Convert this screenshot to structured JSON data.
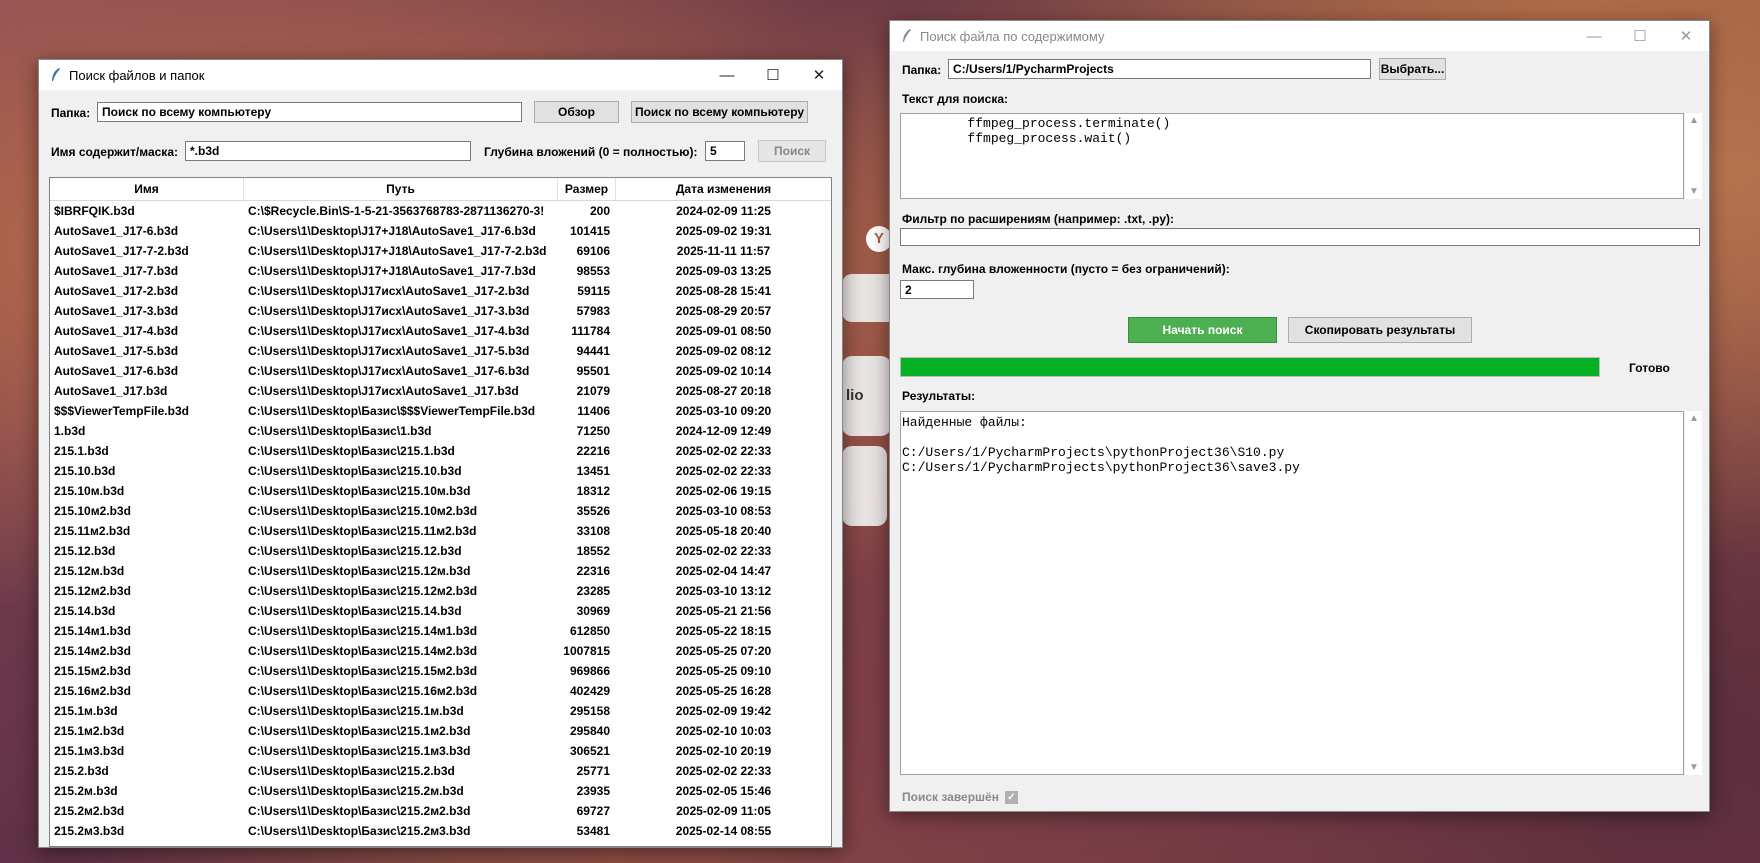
{
  "background": {
    "side_text": "lio"
  },
  "left_window": {
    "title": "Поиск файлов и папок",
    "folder_label": "Папка:",
    "folder_value": "Поиск по всему компьютеру",
    "browse_button": "Обзор",
    "search_all_button": "Поиск по всему компьютеру",
    "mask_label": "Имя содержит/маска:",
    "mask_value": "*.b3d",
    "depth_label": "Глубина вложений (0 = полностью):",
    "depth_value": "5",
    "search_button": "Поиск",
    "columns": [
      "Имя",
      "Путь",
      "Размер",
      "Дата изменения"
    ],
    "rows": [
      [
        "$IBRFQIK.b3d",
        "C:\\$Recycle.Bin\\S-1-5-21-3563768783-2871136270-3!",
        "200",
        "2024-02-09 11:25"
      ],
      [
        "AutoSave1_J17-6.b3d",
        "C:\\Users\\1\\Desktop\\J17+J18\\AutoSave1_J17-6.b3d",
        "101415",
        "2025-09-02 19:31"
      ],
      [
        "AutoSave1_J17-7-2.b3d",
        "C:\\Users\\1\\Desktop\\J17+J18\\AutoSave1_J17-7-2.b3d",
        "69106",
        "2025-11-11 11:57"
      ],
      [
        "AutoSave1_J17-7.b3d",
        "C:\\Users\\1\\Desktop\\J17+J18\\AutoSave1_J17-7.b3d",
        "98553",
        "2025-09-03 13:25"
      ],
      [
        "AutoSave1_J17-2.b3d",
        "C:\\Users\\1\\Desktop\\J17исх\\AutoSave1_J17-2.b3d",
        "59115",
        "2025-08-28 15:41"
      ],
      [
        "AutoSave1_J17-3.b3d",
        "C:\\Users\\1\\Desktop\\J17исх\\AutoSave1_J17-3.b3d",
        "57983",
        "2025-08-29 20:57"
      ],
      [
        "AutoSave1_J17-4.b3d",
        "C:\\Users\\1\\Desktop\\J17исх\\AutoSave1_J17-4.b3d",
        "111784",
        "2025-09-01 08:50"
      ],
      [
        "AutoSave1_J17-5.b3d",
        "C:\\Users\\1\\Desktop\\J17исх\\AutoSave1_J17-5.b3d",
        "94441",
        "2025-09-02 08:12"
      ],
      [
        "AutoSave1_J17-6.b3d",
        "C:\\Users\\1\\Desktop\\J17исх\\AutoSave1_J17-6.b3d",
        "95501",
        "2025-09-02 10:14"
      ],
      [
        "AutoSave1_J17.b3d",
        "C:\\Users\\1\\Desktop\\J17исх\\AutoSave1_J17.b3d",
        "21079",
        "2025-08-27 20:18"
      ],
      [
        "$$$ViewerTempFile.b3d",
        "C:\\Users\\1\\Desktop\\Базис\\$$$ViewerTempFile.b3d",
        "11406",
        "2025-03-10 09:20"
      ],
      [
        "1.b3d",
        "C:\\Users\\1\\Desktop\\Базис\\1.b3d",
        "71250",
        "2024-12-09 12:49"
      ],
      [
        "215.1.b3d",
        "C:\\Users\\1\\Desktop\\Базис\\215.1.b3d",
        "22216",
        "2025-02-02 22:33"
      ],
      [
        "215.10.b3d",
        "C:\\Users\\1\\Desktop\\Базис\\215.10.b3d",
        "13451",
        "2025-02-02 22:33"
      ],
      [
        "215.10м.b3d",
        "C:\\Users\\1\\Desktop\\Базис\\215.10м.b3d",
        "18312",
        "2025-02-06 19:15"
      ],
      [
        "215.10м2.b3d",
        "C:\\Users\\1\\Desktop\\Базис\\215.10м2.b3d",
        "35526",
        "2025-03-10 08:53"
      ],
      [
        "215.11м2.b3d",
        "C:\\Users\\1\\Desktop\\Базис\\215.11м2.b3d",
        "33108",
        "2025-05-18 20:40"
      ],
      [
        "215.12.b3d",
        "C:\\Users\\1\\Desktop\\Базис\\215.12.b3d",
        "18552",
        "2025-02-02 22:33"
      ],
      [
        "215.12м.b3d",
        "C:\\Users\\1\\Desktop\\Базис\\215.12м.b3d",
        "22316",
        "2025-02-04 14:47"
      ],
      [
        "215.12м2.b3d",
        "C:\\Users\\1\\Desktop\\Базис\\215.12м2.b3d",
        "23285",
        "2025-03-10 13:12"
      ],
      [
        "215.14.b3d",
        "C:\\Users\\1\\Desktop\\Базис\\215.14.b3d",
        "30969",
        "2025-05-21 21:56"
      ],
      [
        "215.14м1.b3d",
        "C:\\Users\\1\\Desktop\\Базис\\215.14м1.b3d",
        "612850",
        "2025-05-22 18:15"
      ],
      [
        "215.14м2.b3d",
        "C:\\Users\\1\\Desktop\\Базис\\215.14м2.b3d",
        "1007815",
        "2025-05-25 07:20"
      ],
      [
        "215.15м2.b3d",
        "C:\\Users\\1\\Desktop\\Базис\\215.15м2.b3d",
        "969866",
        "2025-05-25 09:10"
      ],
      [
        "215.16м2.b3d",
        "C:\\Users\\1\\Desktop\\Базис\\215.16м2.b3d",
        "402429",
        "2025-05-25 16:28"
      ],
      [
        "215.1м.b3d",
        "C:\\Users\\1\\Desktop\\Базис\\215.1м.b3d",
        "295158",
        "2025-02-09 19:42"
      ],
      [
        "215.1м2.b3d",
        "C:\\Users\\1\\Desktop\\Базис\\215.1м2.b3d",
        "295840",
        "2025-02-10 10:03"
      ],
      [
        "215.1м3.b3d",
        "C:\\Users\\1\\Desktop\\Базис\\215.1м3.b3d",
        "306521",
        "2025-02-10 20:19"
      ],
      [
        "215.2.b3d",
        "C:\\Users\\1\\Desktop\\Базис\\215.2.b3d",
        "25771",
        "2025-02-02 22:33"
      ],
      [
        "215.2м.b3d",
        "C:\\Users\\1\\Desktop\\Базис\\215.2м.b3d",
        "23935",
        "2025-02-05 15:46"
      ],
      [
        "215.2м2.b3d",
        "C:\\Users\\1\\Desktop\\Базис\\215.2м2.b3d",
        "69727",
        "2025-02-09 11:05"
      ],
      [
        "215.2м3.b3d",
        "C:\\Users\\1\\Desktop\\Базис\\215.2м3.b3d",
        "53481",
        "2025-02-14 08:55"
      ]
    ]
  },
  "right_window": {
    "title": "Поиск файла по содержимому",
    "folder_label": "Папка:",
    "folder_value": "C:/Users/1/PycharmProjects",
    "choose_button": "Выбрать...",
    "search_text_label": "Текст для поиска:",
    "search_text_value": "        ffmpeg_process.terminate()\n        ffmpeg_process.wait()",
    "ext_filter_label": "Фильтр по расширениям (например: .txt, .py):",
    "ext_filter_value": "",
    "max_depth_label": "Макс. глубина вложенности (пусто = без ограничений):",
    "max_depth_value": "2",
    "start_button": "Начать поиск",
    "copy_button": "Скопировать результаты",
    "progress_percent": 100,
    "progress_color": "#06b025",
    "status_text": "Готово",
    "results_label": "Результаты:",
    "results_text": "Найденные файлы:\n\nC:/Users/1/PycharmProjects\\pythonProject36\\S10.py\nC:/Users/1/PycharmProjects\\pythonProject36\\save3.py",
    "footer_status": "Поиск завершён",
    "footer_check": "✓"
  }
}
